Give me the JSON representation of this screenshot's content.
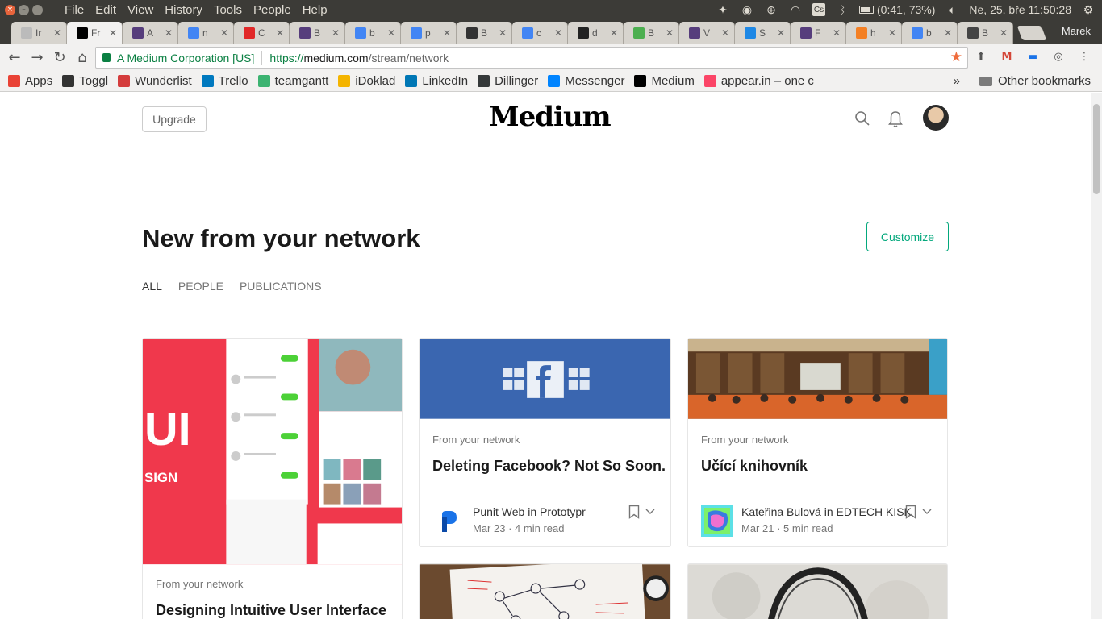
{
  "os": {
    "menus": [
      "File",
      "Edit",
      "View",
      "History",
      "Tools",
      "People",
      "Help"
    ],
    "battery": "(0:41, 73%)",
    "clock": "Ne, 25. bře 11:50:28"
  },
  "browser": {
    "tabs": [
      {
        "title": "Ir",
        "icon": "document-icon",
        "color": "#bbbbbb"
      },
      {
        "title": "Fr",
        "icon": "medium-icon",
        "color": "#000000",
        "active": true
      },
      {
        "title": "A",
        "icon": "bootstrap-icon",
        "color": "#563d7c"
      },
      {
        "title": "n",
        "icon": "google-icon",
        "color": "#4285f4"
      },
      {
        "title": "C",
        "icon": "flipboard-icon",
        "color": "#e12828"
      },
      {
        "title": "B",
        "icon": "bootstrap-icon",
        "color": "#563d7c"
      },
      {
        "title": "b",
        "icon": "google-icon",
        "color": "#4285f4"
      },
      {
        "title": "p",
        "icon": "google-icon",
        "color": "#4285f4"
      },
      {
        "title": "B",
        "icon": "b-icon",
        "color": "#333333"
      },
      {
        "title": "c",
        "icon": "google-icon",
        "color": "#4285f4"
      },
      {
        "title": "d",
        "icon": "github-icon",
        "color": "#222222"
      },
      {
        "title": "B",
        "icon": "w3-icon",
        "color": "#4caf50"
      },
      {
        "title": "V",
        "icon": "bootstrap-icon",
        "color": "#563d7c"
      },
      {
        "title": "S",
        "icon": "heart-icon",
        "color": "#1e88e5"
      },
      {
        "title": "F",
        "icon": "bootstrap-icon",
        "color": "#563d7c"
      },
      {
        "title": "h",
        "icon": "stackoverflow-icon",
        "color": "#f48024"
      },
      {
        "title": "b",
        "icon": "google-icon",
        "color": "#4285f4"
      },
      {
        "title": "B",
        "icon": "codepen-icon",
        "color": "#444444"
      }
    ],
    "profile": "Marek",
    "omnibox": {
      "secure_label": "A Medium Corporation [US]",
      "url_scheme": "https://",
      "url_host": "medium.com",
      "url_path": "/stream/network"
    },
    "bookmarks": [
      {
        "label": "Apps",
        "icon": "apps-grid-icon",
        "color": "#e94235"
      },
      {
        "label": "Toggl",
        "icon": "toggl-icon",
        "color": "#333333"
      },
      {
        "label": "Wunderlist",
        "icon": "wunderlist-icon",
        "color": "#d43c3c"
      },
      {
        "label": "Trello",
        "icon": "trello-icon",
        "color": "#0079bf"
      },
      {
        "label": "teamgantt",
        "icon": "teamgantt-icon",
        "color": "#3cb371"
      },
      {
        "label": "iDoklad",
        "icon": "idoklad-icon",
        "color": "#f4b400"
      },
      {
        "label": "LinkedIn",
        "icon": "linkedin-icon",
        "color": "#0077b5"
      },
      {
        "label": "Dillinger",
        "icon": "dillinger-icon",
        "color": "#35393a"
      },
      {
        "label": "Messenger",
        "icon": "messenger-icon",
        "color": "#0084ff"
      },
      {
        "label": "Medium",
        "icon": "medium-icon",
        "color": "#000000"
      },
      {
        "label": "appear.in – one c",
        "icon": "appearin-icon",
        "color": "#fb4567"
      }
    ],
    "bookmarks_more": "»",
    "other_bookmarks": "Other bookmarks"
  },
  "page": {
    "upgrade": "Upgrade",
    "logo": "Medium",
    "heading": "New from your network",
    "customize": "Customize",
    "filters": [
      "ALL",
      "PEOPLE",
      "PUBLICATIONS"
    ],
    "cards": [
      {
        "meta": "From your network",
        "title": "Designing Intuitive User Interface",
        "image": "ui-design-image"
      },
      {
        "meta": "From your network",
        "title": "Deleting Facebook? Not So Soon.",
        "author": "Punit Web in Prototypr",
        "date": "Mar 23",
        "read": "4 min read",
        "image": "facebook-logos-image"
      },
      {
        "meta": "From your network",
        "title": "Učící knihovník",
        "author": "Kateřina Bulová in EDTECH KISK",
        "date": "Mar 21",
        "read": "5 min read",
        "image": "library-hall-image"
      },
      {
        "image": "whiteboard-diagram-image"
      },
      {
        "image": "headphones-image"
      }
    ]
  }
}
